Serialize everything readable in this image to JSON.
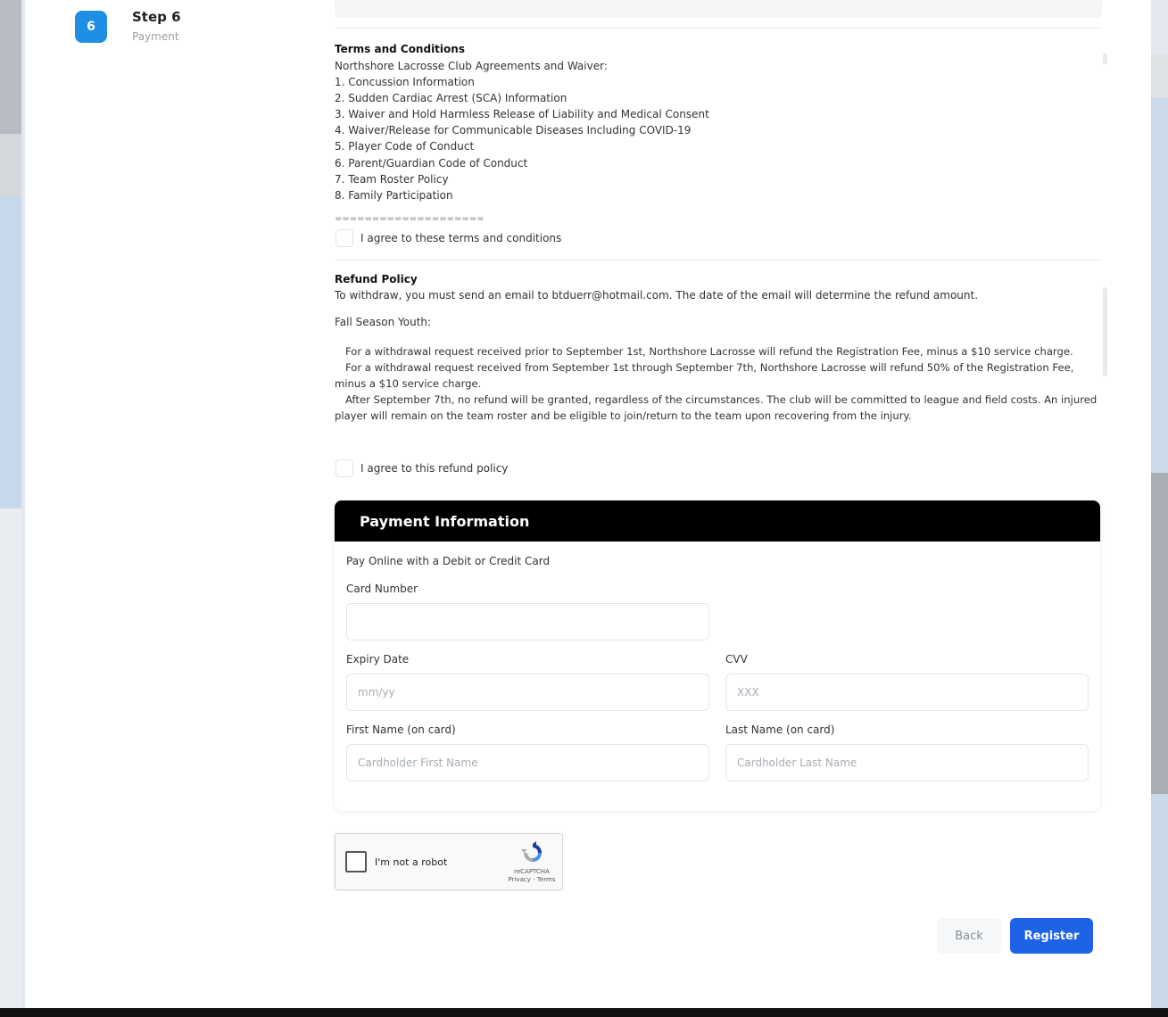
{
  "step": {
    "number": "6",
    "title": "Step 6",
    "subtitle": "Payment"
  },
  "terms": {
    "title": "Terms and Conditions",
    "intro": "Northshore Lacrosse Club Agreements and Waiver:",
    "items": [
      "1. Concussion Information",
      "2. Sudden Cardiac Arrest (SCA) Information",
      "3. Waiver and Hold Harmless Release of Liability and Medical Consent",
      "4. Waiver/Release for Communicable Diseases Including COVID-19",
      "5. Player Code of Conduct",
      "6. Parent/Guardian Code of Conduct",
      "7. Team Roster Policy",
      "8. Family Participation"
    ],
    "separator": "====================",
    "agree_label": "I agree to these terms and conditions"
  },
  "refund": {
    "title": "Refund Policy",
    "line1": "To withdraw, you must send an email to btduerr@hotmail.com. The date of the email will determine the refund amount.",
    "season": "Fall Season Youth:",
    "p1": "For a withdrawal request received prior to September 1st, Northshore Lacrosse will refund the Registration Fee, minus a $10 service charge.",
    "p2": "For a withdrawal request received from September 1st through September 7th, Northshore Lacrosse will refund 50% of the Registration Fee, minus a $10 service charge.",
    "p3": "After September 7th, no refund will be granted, regardless of the circumstances. The club will be committed to league and field costs. An injured player will remain on the team roster and be eligible to join/return to the team upon recovering from the injury.",
    "agree_label": "I agree to this refund policy"
  },
  "payment": {
    "header": "Payment Information",
    "subtitle": "Pay Online with a Debit or Credit Card",
    "card_number_label": "Card Number",
    "card_number_value": "",
    "expiry_label": "Expiry Date",
    "expiry_placeholder": "mm/yy",
    "cvv_label": "CVV",
    "cvv_placeholder": "XXX",
    "first_name_label": "First Name (on card)",
    "first_name_placeholder": "Cardholder First Name",
    "last_name_label": "Last Name (on card)",
    "last_name_placeholder": "Cardholder Last Name"
  },
  "captcha": {
    "label": "I'm not a robot",
    "brand": "reCAPTCHA",
    "links": "Privacy - Terms"
  },
  "actions": {
    "back_label": "Back",
    "register_label": "Register"
  },
  "colors": {
    "step_badge": "#1f8fe6",
    "register": "#1e63e6",
    "payment_header": "#000000"
  }
}
